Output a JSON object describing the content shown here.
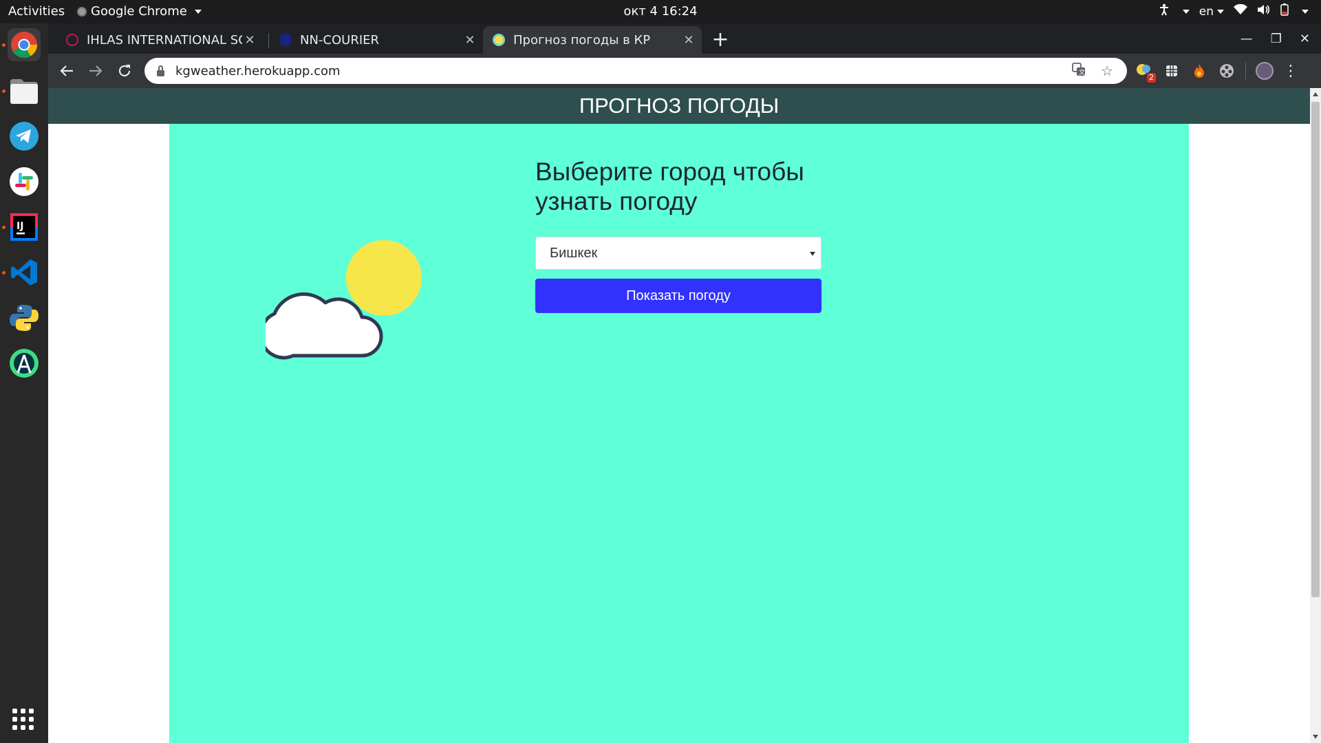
{
  "system": {
    "activities": "Activities",
    "app_name": "Google Chrome",
    "clock": "окт 4  16:24",
    "lang": "en"
  },
  "tabs": [
    {
      "title": "IHLAS INTERNATIONAL SCHOOL",
      "favicon_color": "#c2185b",
      "active": false
    },
    {
      "title": "NN-COURIER",
      "favicon_color": "#1a237e",
      "active": false
    },
    {
      "title": "Прогноз погоды в КР",
      "favicon_color": "#f9e04b",
      "active": true
    }
  ],
  "toolbar": {
    "url": "kgweather.herokuapp.com"
  },
  "extensions": {
    "badge_count": "2"
  },
  "page": {
    "header_title": "ПРОГНОЗ ПОГОДЫ",
    "heading": "Выберите город чтобы узнать погоду",
    "city_selected": "Бишкек",
    "show_button": "Показать погоду"
  },
  "colors": {
    "header_bg": "#2f4f4f",
    "panel_bg": "#5fffd7",
    "button_bg": "#3232ff",
    "sun": "#f7e64a",
    "cloud_stroke": "#2e3a52"
  }
}
